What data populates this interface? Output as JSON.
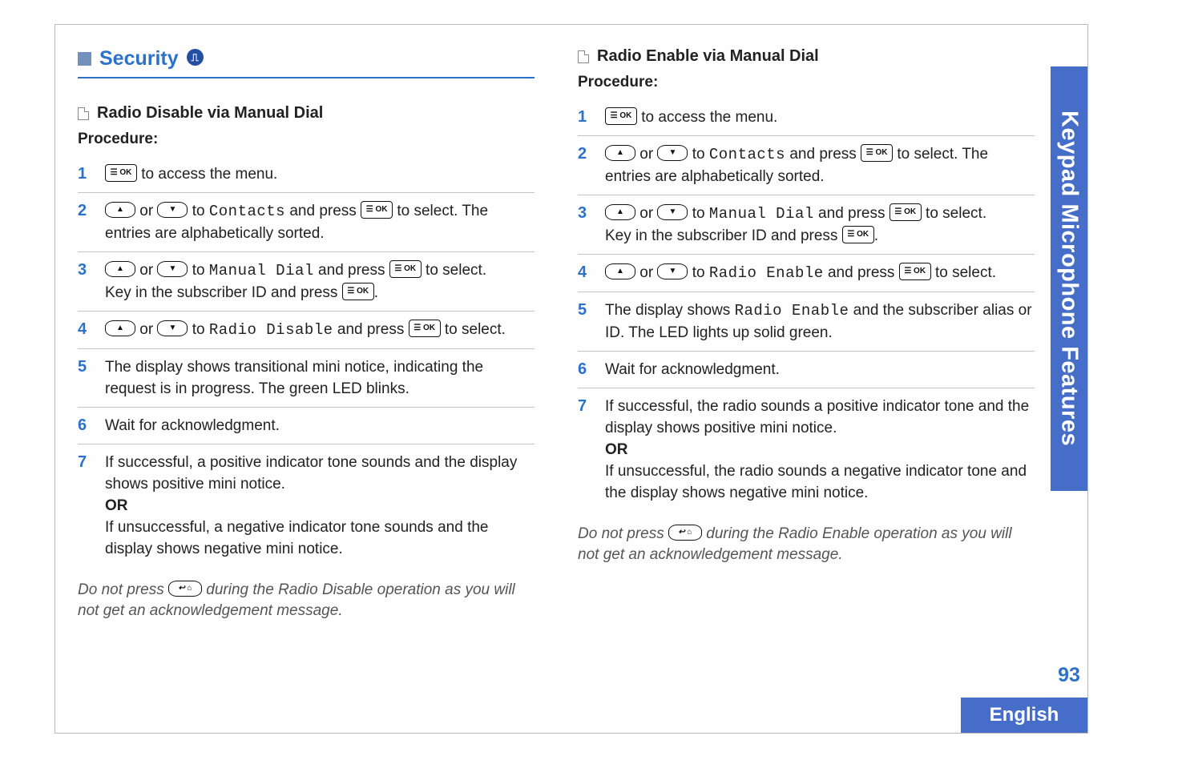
{
  "sidebar": {
    "tab": "Keypad Microphone Features",
    "page_number": "93",
    "language": "English"
  },
  "heading": {
    "title": "Security",
    "feature_icon_label": "feature"
  },
  "keys": {
    "ok": "☰ OK",
    "back": "↩ ⌂"
  },
  "left": {
    "subtitle": "Radio Disable via Manual Dial",
    "procedure_label": "Procedure:",
    "steps": {
      "s1": {
        "n": "1",
        "pre": "",
        "post": " to access the menu."
      },
      "s2": {
        "n": "2",
        "mid1": " or ",
        "mid2": " to ",
        "menu": "Contacts",
        "mid3": " and press ",
        "tail": " to select. The entries are alphabetically sorted."
      },
      "s3": {
        "n": "3",
        "mid1": " or ",
        "mid2": " to ",
        "menu": "Manual Dial",
        "mid3": " and press ",
        "tail1": " to select.",
        "line2a": "Key in the subscriber ID and press ",
        "line2b": "."
      },
      "s4": {
        "n": "4",
        "mid1": " or ",
        "mid2": " to ",
        "menu": "Radio Disable",
        "mid3": " and press ",
        "tail": " to select."
      },
      "s5": {
        "n": "5",
        "text": "The display shows transitional mini notice, indicating the request is in progress. The green LED blinks."
      },
      "s6": {
        "n": "6",
        "text": "Wait for acknowledgment."
      },
      "s7": {
        "n": "7",
        "part1": "If successful, a positive indicator tone sounds and the display shows positive mini notice.",
        "or": "OR",
        "part2": "If unsuccessful, a negative indicator tone sounds and the display shows negative mini notice."
      }
    },
    "note_a": "Do not press ",
    "note_b": " during the Radio  Disable operation as you will not get an acknowledgement message."
  },
  "right": {
    "subtitle": "Radio Enable via Manual Dial",
    "procedure_label": "Procedure:",
    "steps": {
      "s1": {
        "n": "1",
        "post": " to access the menu."
      },
      "s2": {
        "n": "2",
        "mid1": " or ",
        "mid2": " to ",
        "menu": "Contacts",
        "mid3": " and press ",
        "tail": " to select. The entries are alphabetically sorted."
      },
      "s3": {
        "n": "3",
        "mid1": " or ",
        "mid2": " to ",
        "menu": "Manual Dial",
        "mid3": " and press ",
        "tail1": " to select.",
        "line2a": "Key in the subscriber ID and press ",
        "line2b": "."
      },
      "s4": {
        "n": "4",
        "mid1": " or ",
        "mid2": " to ",
        "menu": "Radio Enable",
        "mid3": " and press ",
        "tail": " to select."
      },
      "s5": {
        "n": "5",
        "pre": "The display shows ",
        "menu": "Radio Enable",
        "post": " and the subscriber alias or ID. The LED lights up solid green."
      },
      "s6": {
        "n": "6",
        "text": "Wait for acknowledgment."
      },
      "s7": {
        "n": "7",
        "part1": "If successful, the radio sounds a positive indicator tone and the display shows positive mini notice.",
        "or": "OR",
        "part2": "If unsuccessful, the radio sounds a negative indicator tone and the display shows negative mini notice."
      }
    },
    "note_a": "Do not press ",
    "note_b": " during the Radio Enable operation as you will not get an acknowledgement message."
  }
}
